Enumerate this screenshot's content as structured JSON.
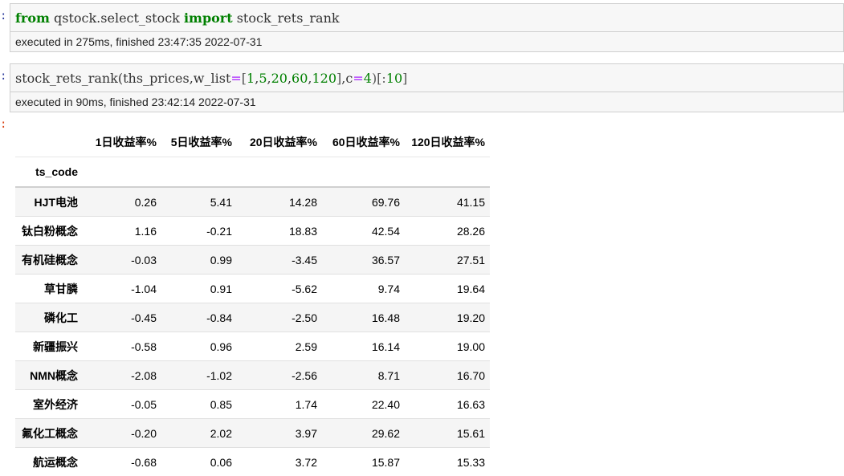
{
  "cell1": {
    "code_tokens": [
      {
        "t": "from",
        "cls": "kw"
      },
      {
        "t": " qstock.select_stock ",
        "cls": ""
      },
      {
        "t": "import",
        "cls": "kw"
      },
      {
        "t": " stock_rets_rank",
        "cls": ""
      }
    ],
    "exec_info": "executed in 275ms, finished 23:47:35 2022-07-31"
  },
  "cell2": {
    "code_tokens": [
      {
        "t": "stock_rets_rank(ths_prices,w_list",
        "cls": ""
      },
      {
        "t": "=",
        "cls": "op"
      },
      {
        "t": "[",
        "cls": "brk"
      },
      {
        "t": "1",
        "cls": "num"
      },
      {
        "t": ",",
        "cls": ""
      },
      {
        "t": "5",
        "cls": "num"
      },
      {
        "t": ",",
        "cls": ""
      },
      {
        "t": "20",
        "cls": "num"
      },
      {
        "t": ",",
        "cls": ""
      },
      {
        "t": "60",
        "cls": "num"
      },
      {
        "t": ",",
        "cls": ""
      },
      {
        "t": "120",
        "cls": "num"
      },
      {
        "t": "]",
        "cls": "brk"
      },
      {
        "t": ",c",
        "cls": ""
      },
      {
        "t": "=",
        "cls": "op"
      },
      {
        "t": "4",
        "cls": "num"
      },
      {
        "t": ")[:",
        "cls": "brk"
      },
      {
        "t": "10",
        "cls": "num"
      },
      {
        "t": "]",
        "cls": "brk"
      }
    ],
    "exec_info": "executed in 90ms, finished 23:42:14 2022-07-31"
  },
  "prompt_colon": ":",
  "table": {
    "columns": [
      "1日收益率%",
      "5日收益率%",
      "20日收益率%",
      "60日收益率%",
      "120日收益率%"
    ],
    "index_name": "ts_code",
    "rows": [
      {
        "name": "HJT电池",
        "values": [
          "0.26",
          "5.41",
          "14.28",
          "69.76",
          "41.15"
        ]
      },
      {
        "name": "钛白粉概念",
        "values": [
          "1.16",
          "-0.21",
          "18.83",
          "42.54",
          "28.26"
        ]
      },
      {
        "name": "有机硅概念",
        "values": [
          "-0.03",
          "0.99",
          "-3.45",
          "36.57",
          "27.51"
        ]
      },
      {
        "name": "草甘膦",
        "values": [
          "-1.04",
          "0.91",
          "-5.62",
          "9.74",
          "19.64"
        ]
      },
      {
        "name": "磷化工",
        "values": [
          "-0.45",
          "-0.84",
          "-2.50",
          "16.48",
          "19.20"
        ]
      },
      {
        "name": "新疆振兴",
        "values": [
          "-0.58",
          "0.96",
          "2.59",
          "16.14",
          "19.00"
        ]
      },
      {
        "name": "NMN概念",
        "values": [
          "-2.08",
          "-1.02",
          "-2.56",
          "8.71",
          "16.70"
        ]
      },
      {
        "name": "室外经济",
        "values": [
          "-0.05",
          "0.85",
          "1.74",
          "22.40",
          "16.63"
        ]
      },
      {
        "name": "氟化工概念",
        "values": [
          "-0.20",
          "2.02",
          "3.97",
          "29.62",
          "15.61"
        ]
      },
      {
        "name": "航运概念",
        "values": [
          "-0.68",
          "0.06",
          "3.72",
          "15.87",
          "15.33"
        ]
      }
    ]
  }
}
